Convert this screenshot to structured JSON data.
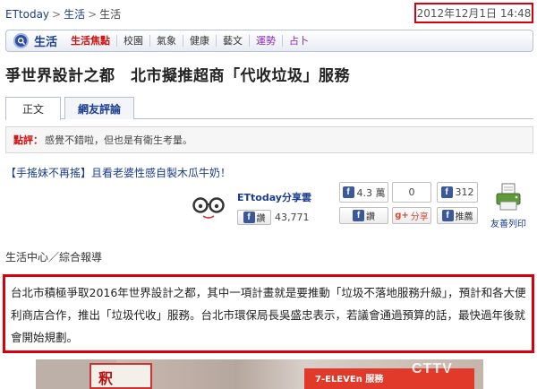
{
  "breadcrumb": {
    "home": "ETtoday",
    "sep": ">",
    "section": "生活",
    "current": "生活"
  },
  "date_text": "2012年12月1日 14:48",
  "nav": {
    "section_label": "生活",
    "items": [
      {
        "label": "生活焦點",
        "style": "hot"
      },
      {
        "label": "校園",
        "style": "normal"
      },
      {
        "label": "氣象",
        "style": "normal"
      },
      {
        "label": "健康",
        "style": "normal"
      },
      {
        "label": "藝文",
        "style": "normal"
      },
      {
        "label": "運勢",
        "style": "purple"
      },
      {
        "label": "占卜",
        "style": "purple"
      }
    ],
    "colors": {
      "hot": "#d10d0d",
      "purple": "#8a2ab0",
      "brand": "#1e3f8a"
    }
  },
  "article": {
    "title": "爭世界設計之都　北市擬推超商「代收垃圾」服務",
    "tabs": {
      "main": "正文",
      "comments": "網友評論"
    },
    "comment_label": "點評：",
    "comment_text": "感覺不錯啦，但也是有衛生考量。",
    "promo_link": "【手搖妹不再搖】且看老婆性感自製木瓜牛奶！",
    "byline": "生活中心／綜合報導",
    "paragraph": "台北市積極爭取2016年世界設計之都，其中一項計畫就是要推動「垃圾不落地服務升級」，預計和各大便利商店合作，推出「垃圾代收」服務。台北市環保局長吳盛忠表示，若議會通過預算的話，最快過年後就會開始規劃。"
  },
  "share": {
    "name": "ETtoday分享雲",
    "fb_button": "讚",
    "fb_icon": "f",
    "count": "43,771",
    "widgets": [
      {
        "top": "4.3 萬",
        "button": "讚",
        "icon": "facebook-icon"
      },
      {
        "top": "0",
        "button": "分享",
        "icon": "google-plus-icon"
      },
      {
        "top": "312",
        "button": "推薦",
        "icon": "facebook-icon"
      }
    ],
    "print_label": "友善列印"
  },
  "photo": {
    "sign_left": "釈",
    "sign_right": "7-ELEVEn 服務",
    "watermark": "CTTV"
  }
}
